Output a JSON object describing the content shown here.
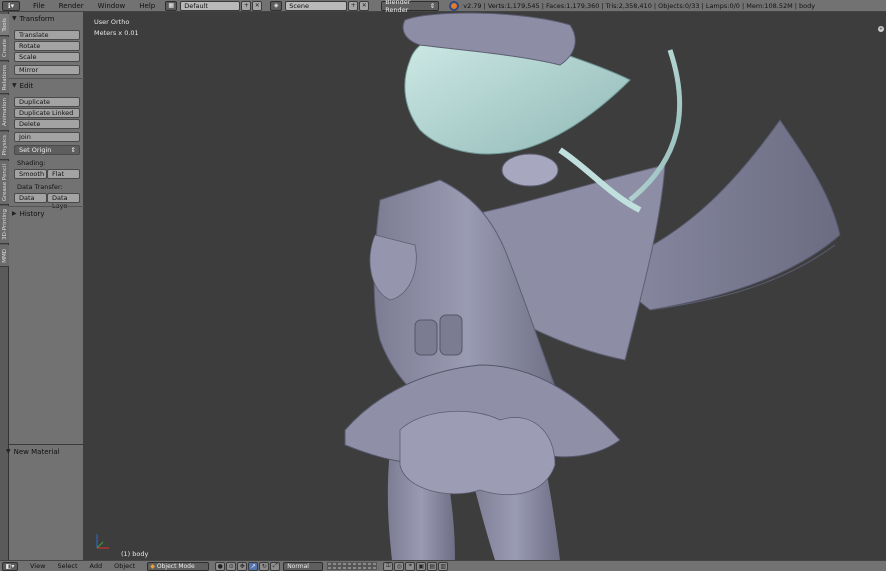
{
  "top_header": {
    "menus": [
      "File",
      "Render",
      "Window",
      "Help"
    ],
    "screen_layout": "Default",
    "scene": "Scene",
    "render_engine": "Blender Render",
    "stats": "v2.79 | Verts:1,179,545 | Faces:1,179,360 | Tris:2,358,410 | Objects:0/33 | Lamps:0/0 | Mem:108.52M | body"
  },
  "tabs": [
    "Tools",
    "Create",
    "Relations",
    "Animation",
    "Physics",
    "Grease Pencil",
    "3D-Printing",
    "MMD"
  ],
  "tool_shelf": {
    "transform": {
      "title": "Transform",
      "buttons": [
        "Translate",
        "Rotate",
        "Scale",
        "Mirror"
      ]
    },
    "edit": {
      "title": "Edit",
      "buttons": [
        "Duplicate",
        "Duplicate Linked",
        "Delete",
        "Join"
      ],
      "set_origin": "Set Origin",
      "shading_label": "Shading:",
      "smooth": "Smooth",
      "flat": "Flat",
      "data_transfer_label": "Data Transfer:",
      "data": "Data",
      "data_layout": "Data Layo"
    },
    "history": "History",
    "operator_panel": "New Material"
  },
  "viewport": {
    "view_name": "User Ortho",
    "units": "Meters x 0.01",
    "object_info": "(1) body"
  },
  "bottom_header": {
    "menus": [
      "View",
      "Select",
      "Add",
      "Object"
    ],
    "mode": "Object Mode",
    "orientation": "Normal"
  },
  "colors": {
    "viewport_bg": "#3d3d3d",
    "header_bg": "#727272",
    "model_gray": "#8d8ea6",
    "hair_tint": "#b8d9d6"
  }
}
